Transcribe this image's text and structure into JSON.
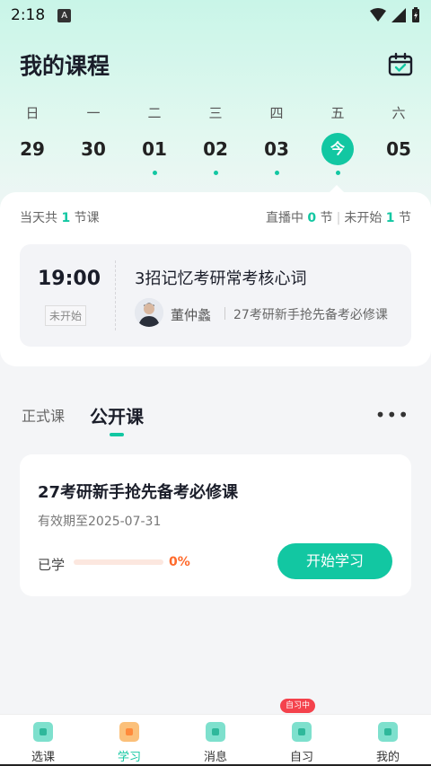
{
  "status": {
    "time": "2:18",
    "a_label": "A"
  },
  "header": {
    "title": "我的课程"
  },
  "calendar": {
    "days": [
      {
        "weekday": "日",
        "date": "29",
        "has_class": false
      },
      {
        "weekday": "一",
        "date": "30",
        "has_class": false
      },
      {
        "weekday": "二",
        "date": "01",
        "has_class": true
      },
      {
        "weekday": "三",
        "date": "02",
        "has_class": true
      },
      {
        "weekday": "四",
        "date": "03",
        "has_class": true
      },
      {
        "weekday": "五",
        "date": "今",
        "has_class": true,
        "today": true
      },
      {
        "weekday": "六",
        "date": "05",
        "has_class": false
      }
    ]
  },
  "summary": {
    "total_prefix": "当天共",
    "total_count": "1",
    "total_suffix": "节课",
    "live_label": "直播中",
    "live_count": "0",
    "live_unit": "节",
    "pending_label": "未开始",
    "pending_count": "1",
    "pending_unit": "节"
  },
  "lesson": {
    "time": "19:00",
    "status": "未开始",
    "title": "3招记忆考研常考核心词",
    "teacher": "董仲蠡",
    "course": "27考研新手抢先备考必修课"
  },
  "tabs": [
    {
      "label": "正式课",
      "active": false
    },
    {
      "label": "公开课",
      "active": true
    }
  ],
  "more_label": "•••",
  "course_card": {
    "title": "27考研新手抢先备考必修课",
    "valid_until": "有效期至2025-07-31",
    "learned_label": "已学",
    "progress": 0,
    "progress_text": "0%",
    "start_button": "开始学习"
  },
  "nav": {
    "items": [
      {
        "label": "选课",
        "active": false
      },
      {
        "label": "学习",
        "active": true
      },
      {
        "label": "消息",
        "active": false
      },
      {
        "label": "自习",
        "active": false,
        "badge": "自习中"
      },
      {
        "label": "我的",
        "active": false
      }
    ]
  },
  "colors": {
    "accent": "#12c7a2",
    "progress": "#ff6a2b",
    "badge": "#f4424c"
  }
}
